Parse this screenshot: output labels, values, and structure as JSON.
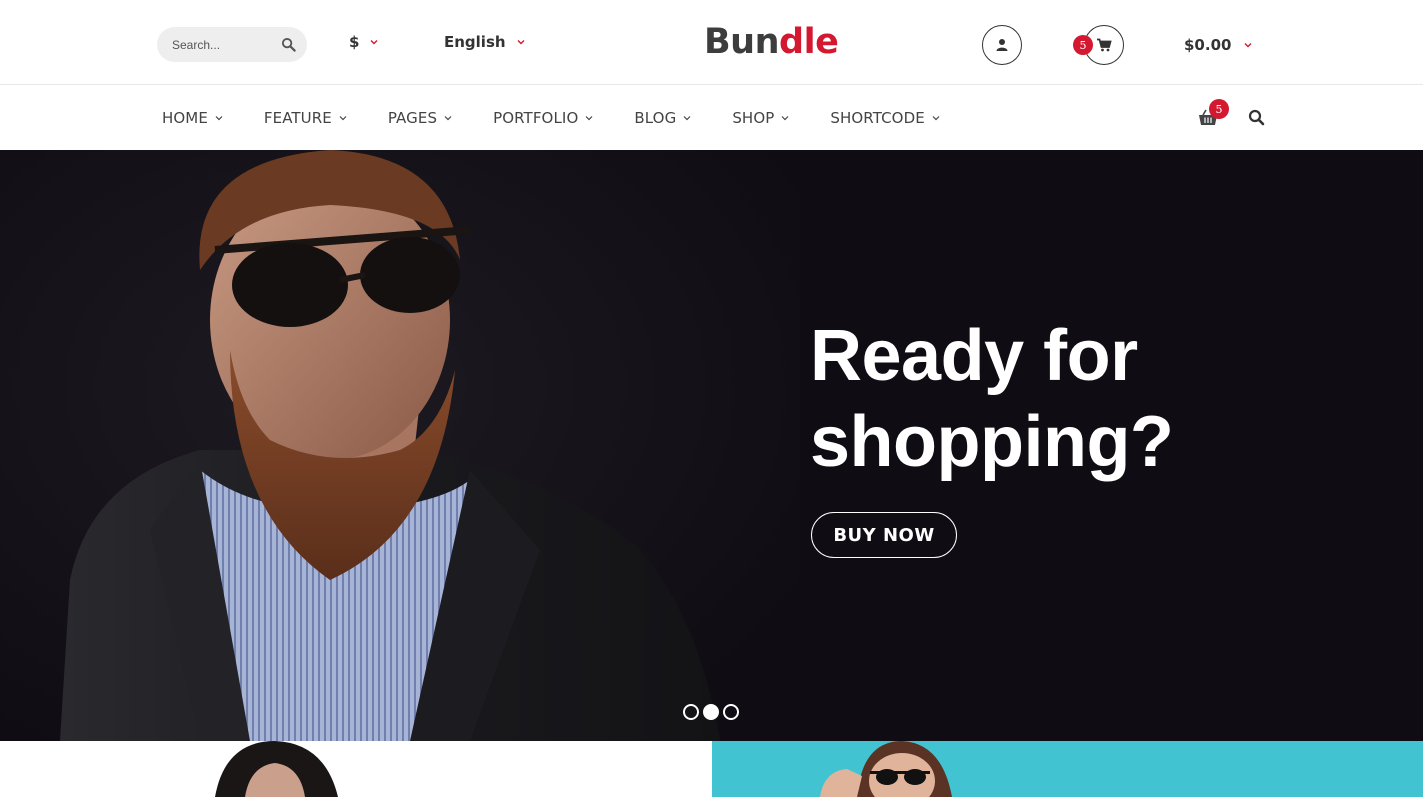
{
  "header": {
    "search": {
      "placeholder": "Search...",
      "value": ""
    },
    "currency": {
      "selected": "$"
    },
    "language": {
      "selected": "English"
    },
    "logo": {
      "part1": "Bun",
      "part2": "dle"
    },
    "cart": {
      "count": "5",
      "total": "$0.00"
    }
  },
  "nav": {
    "items": [
      {
        "label": "HOME"
      },
      {
        "label": "FEATURE"
      },
      {
        "label": "PAGES"
      },
      {
        "label": "PORTFOLIO"
      },
      {
        "label": "BLOG"
      },
      {
        "label": "SHOP"
      },
      {
        "label": "SHORTCODE"
      }
    ],
    "basket_count": "5"
  },
  "hero": {
    "title_line1": "Ready for",
    "title_line2": "shopping?",
    "button_label": "BUY NOW",
    "slides_total": 3,
    "active_slide": 2
  },
  "icons": {
    "search": "search-icon",
    "chevron": "chevron-down-icon",
    "account": "user-icon",
    "cart": "cart-icon",
    "basket": "basket-icon"
  },
  "colors": {
    "accent": "#d41830",
    "hero_bg": "#0f0d13",
    "banner_teal": "#42c3d2",
    "search_bg": "#eeeeee"
  }
}
